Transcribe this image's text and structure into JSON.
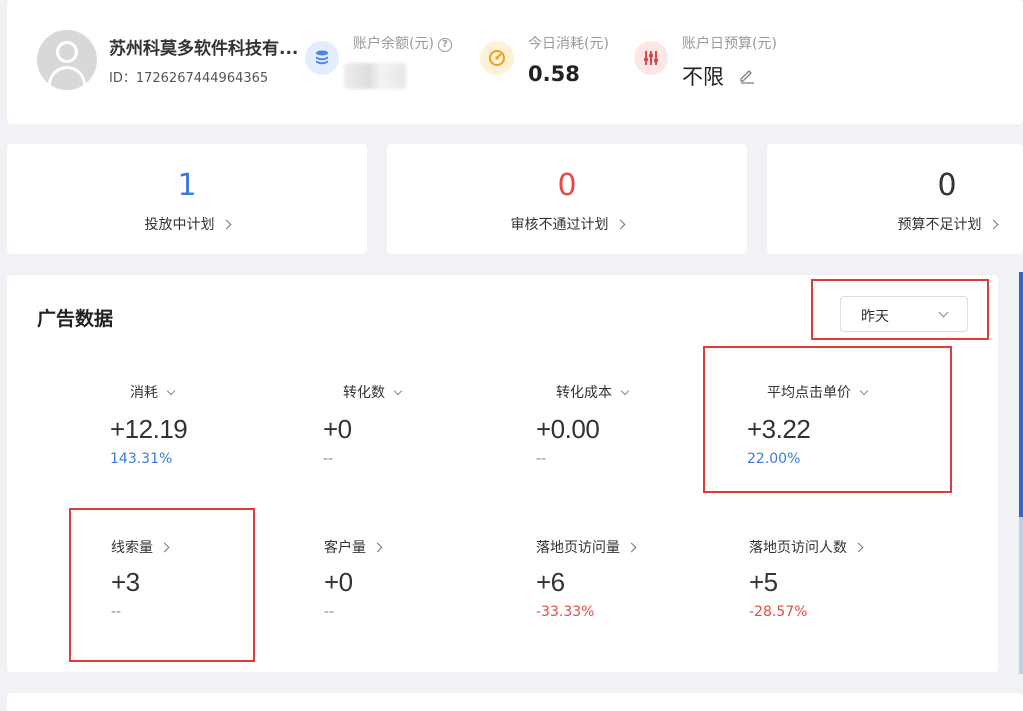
{
  "header": {
    "company_name": "苏州科莫多软件科技有...",
    "account_id": "ID：1726267444964365",
    "balance": {
      "label": "账户余额(元)",
      "help": "?",
      "value_hidden": true,
      "icon": "database-icon",
      "color": "#4a86e8"
    },
    "today_spend": {
      "label": "今日消耗(元)",
      "value": "0.58",
      "icon": "gauge-icon",
      "color": "#f0a020"
    },
    "daily_budget": {
      "label": "账户日预算(元)",
      "value": "不限",
      "icon": "sliders-icon",
      "color": "#e04646"
    }
  },
  "summary": [
    {
      "value": "1",
      "label": "投放中计划",
      "color": "#3a7be0"
    },
    {
      "value": "0",
      "label": "审核不通过计划",
      "color": "#e84a4a"
    },
    {
      "value": "0",
      "label": "预算不足计划",
      "color": "#333333"
    }
  ],
  "ad_data": {
    "title": "广告数据",
    "period_select": "昨天",
    "metrics": [
      {
        "label": "消耗",
        "value": "+12.19",
        "change": "143.31%",
        "change_color": "#3a7be0",
        "expand": "down"
      },
      {
        "label": "转化数",
        "value": "+0",
        "change": "--",
        "change_color": "#888888",
        "expand": "down"
      },
      {
        "label": "转化成本",
        "value": "+0.00",
        "change": "--",
        "change_color": "#888888",
        "expand": "down"
      },
      {
        "label": "平均点击单价",
        "value": "+3.22",
        "change": "22.00%",
        "change_color": "#3a7be0",
        "expand": "down"
      },
      {
        "label": "线索量",
        "value": "+3",
        "change": "--",
        "change_color": "#888888",
        "expand": "right"
      },
      {
        "label": "客户量",
        "value": "+0",
        "change": "--",
        "change_color": "#888888",
        "expand": "right"
      },
      {
        "label": "落地页访问量",
        "value": "+6",
        "change": "-33.33%",
        "change_color": "#e84a4a",
        "expand": "right"
      },
      {
        "label": "落地页访问人数",
        "value": "+5",
        "change": "-28.57%",
        "change_color": "#e84a4a",
        "expand": "right"
      }
    ]
  }
}
